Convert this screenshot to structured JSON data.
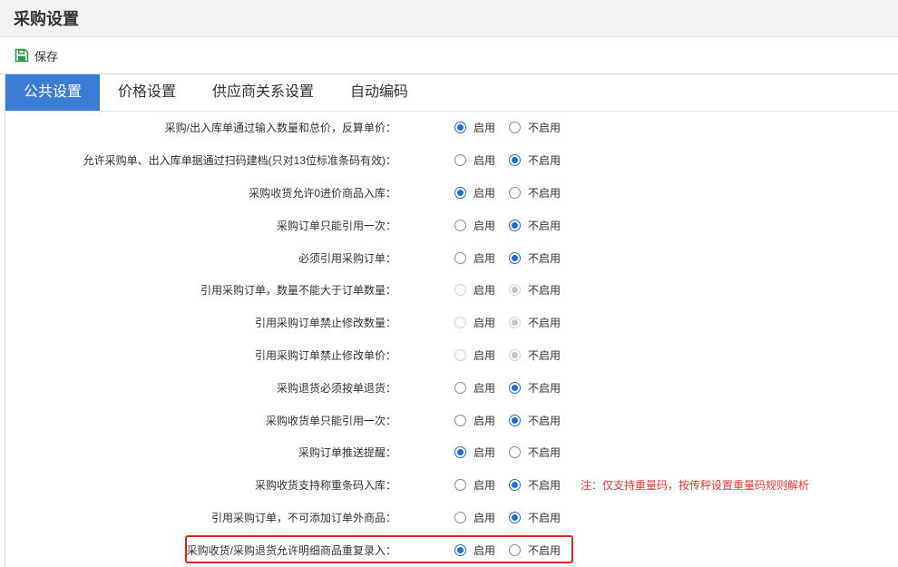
{
  "title": "采购设置",
  "toolbar": {
    "save_icon": "save-icon",
    "save_label": "保存"
  },
  "tabs": [
    {
      "label": "公共设置",
      "active": true
    },
    {
      "label": "价格设置",
      "active": false
    },
    {
      "label": "供应商关系设置",
      "active": false
    },
    {
      "label": "自动编码",
      "active": false
    }
  ],
  "radio_labels": {
    "enable": "启用",
    "disable": "不启用"
  },
  "settings": [
    {
      "label": "采购/出入库单通过输入数量和总价，反算单价：",
      "enabled": true,
      "disabled": false
    },
    {
      "label": "允许采购单、出入库单据通过扫码建档(只对13位标准条码有效)：",
      "enabled": false,
      "disabled": false
    },
    {
      "label": "采购收货允许0进价商品入库：",
      "enabled": true,
      "disabled": false
    },
    {
      "label": "采购订单只能引用一次：",
      "enabled": false,
      "disabled": false
    },
    {
      "label": "必须引用采购订单：",
      "enabled": false,
      "disabled": false
    },
    {
      "label": "引用采购订单，数量不能大于订单数量：",
      "enabled": false,
      "disabled": true
    },
    {
      "label": "引用采购订单禁止修改数量：",
      "enabled": false,
      "disabled": true
    },
    {
      "label": "引用采购订单禁止修改单价：",
      "enabled": false,
      "disabled": true
    },
    {
      "label": "采购退货必须按单退货：",
      "enabled": false,
      "disabled": false
    },
    {
      "label": "采购收货单只能引用一次：",
      "enabled": false,
      "disabled": false
    },
    {
      "label": "采购订单推送提醒：",
      "enabled": true,
      "disabled": false
    },
    {
      "label": "采购收货支持称重条码入库：",
      "enabled": false,
      "disabled": false,
      "note": "注：仅支持重量码，按传秤设置重量码规则解析"
    },
    {
      "label": "引用采购订单，不可添加订单外商品：",
      "enabled": false,
      "disabled": false
    },
    {
      "label": "采购收货/采购退货允许明细商品重复录入：",
      "enabled": true,
      "disabled": false,
      "highlighted": true
    }
  ],
  "colors": {
    "accent": "#3b7dd4",
    "radio": "#1f6fd8",
    "note": "#e8382f",
    "highlight": "#e02424",
    "save_icon": "#2e9b46"
  }
}
